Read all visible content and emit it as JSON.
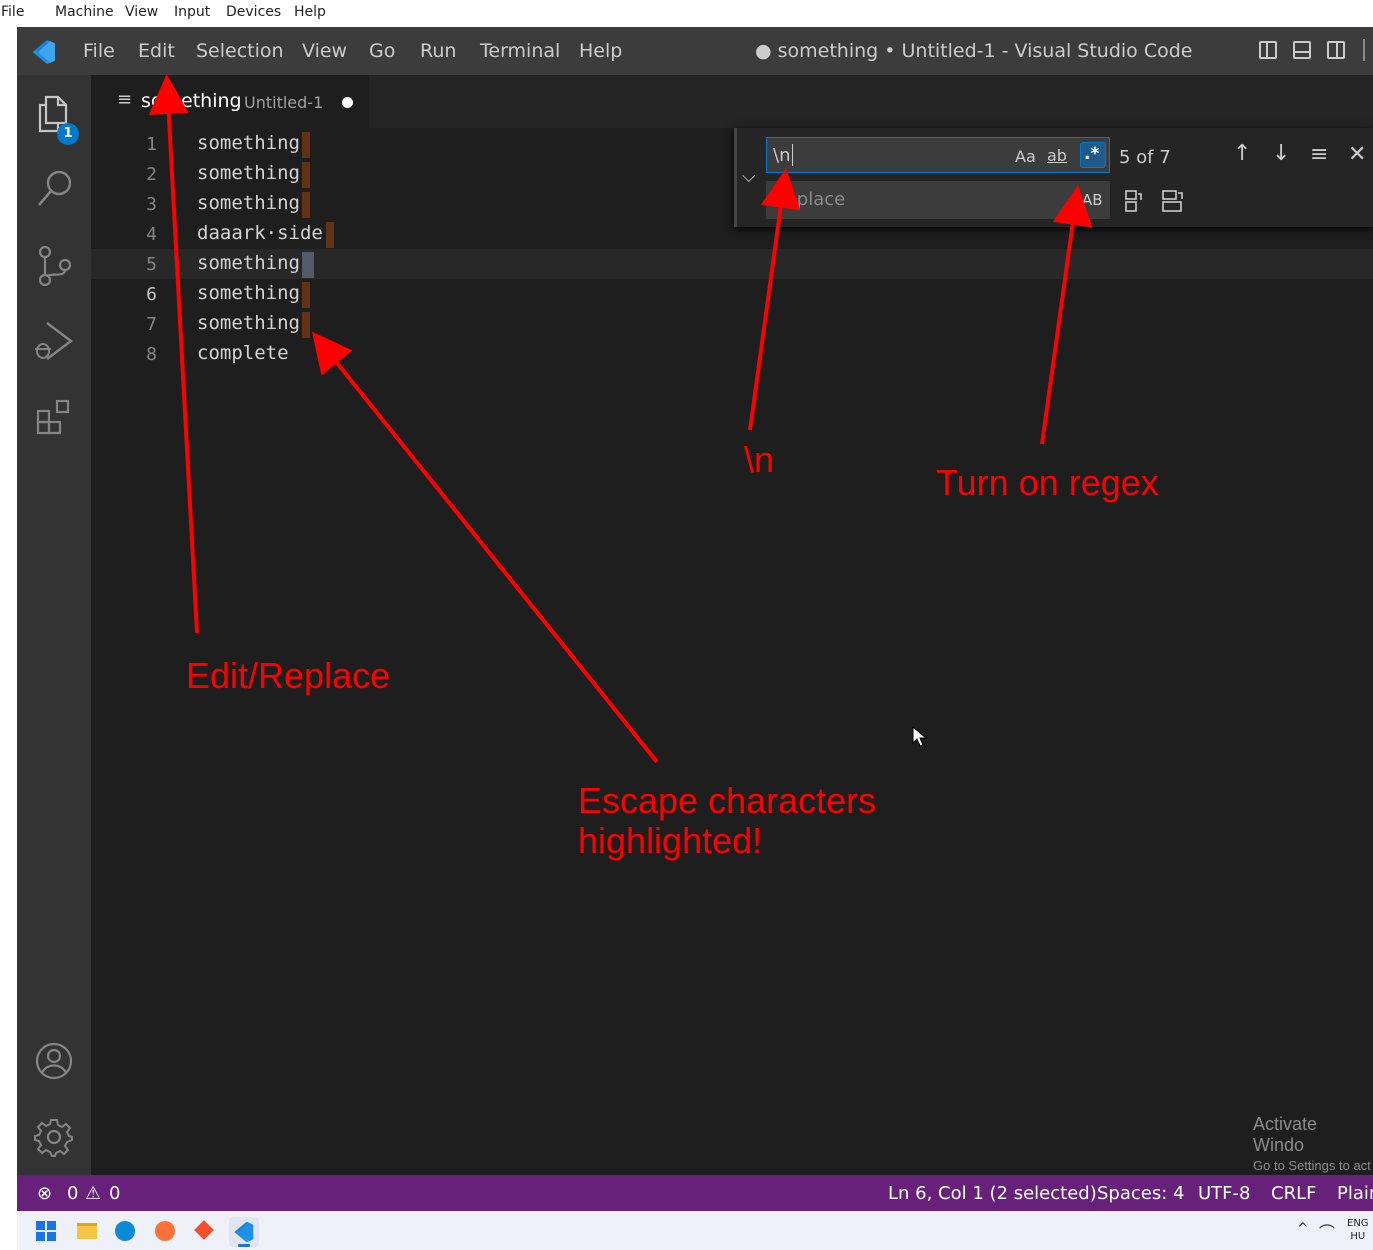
{
  "host_menu": [
    "File",
    "Machine",
    "View",
    "Input",
    "Devices",
    "Help"
  ],
  "menu": [
    "File",
    "Edit",
    "Selection",
    "View",
    "Go",
    "Run",
    "Terminal",
    "Help"
  ],
  "window_title": "● something • Untitled-1 - Visual Studio Code",
  "explorer_badge": "1",
  "tab": {
    "name": "something",
    "description": "Untitled-1"
  },
  "lines": [
    {
      "num": "1",
      "text": "something"
    },
    {
      "num": "2",
      "text": "something"
    },
    {
      "num": "3",
      "text": "something"
    },
    {
      "num": "4",
      "text": "daaark·side"
    },
    {
      "num": "5",
      "text": "something"
    },
    {
      "num": "6",
      "text": "something"
    },
    {
      "num": "7",
      "text": "something"
    },
    {
      "num": "8",
      "text": "complete"
    }
  ],
  "find": {
    "query": "\\n",
    "replace_placeholder": "Replace",
    "match_case": "Aa",
    "whole_word": "ab",
    "regex": ".*",
    "preserve_case": "AB",
    "result": "5 of 7"
  },
  "status": {
    "errors": "0",
    "warnings": "0",
    "position": "Ln 6, Col 1 (2 selected)",
    "spaces": "Spaces: 4",
    "encoding": "UTF-8",
    "eol": "CRLF",
    "language": "Plain"
  },
  "watermark": {
    "title": "Activate Windo",
    "sub": "Go to Settings to act"
  },
  "tray": {
    "lang": "ENG",
    "region": "HU"
  },
  "annotations": {
    "edit_replace": "Edit/Replace",
    "newline": "\\n",
    "regex": "Turn on regex",
    "escape_line1": "Escape characters",
    "escape_line2": "highlighted!"
  },
  "colors": {
    "accent": "#007acc",
    "statusbar": "#68217a",
    "annotation": "#ff0000",
    "match_highlight": "#613214"
  }
}
